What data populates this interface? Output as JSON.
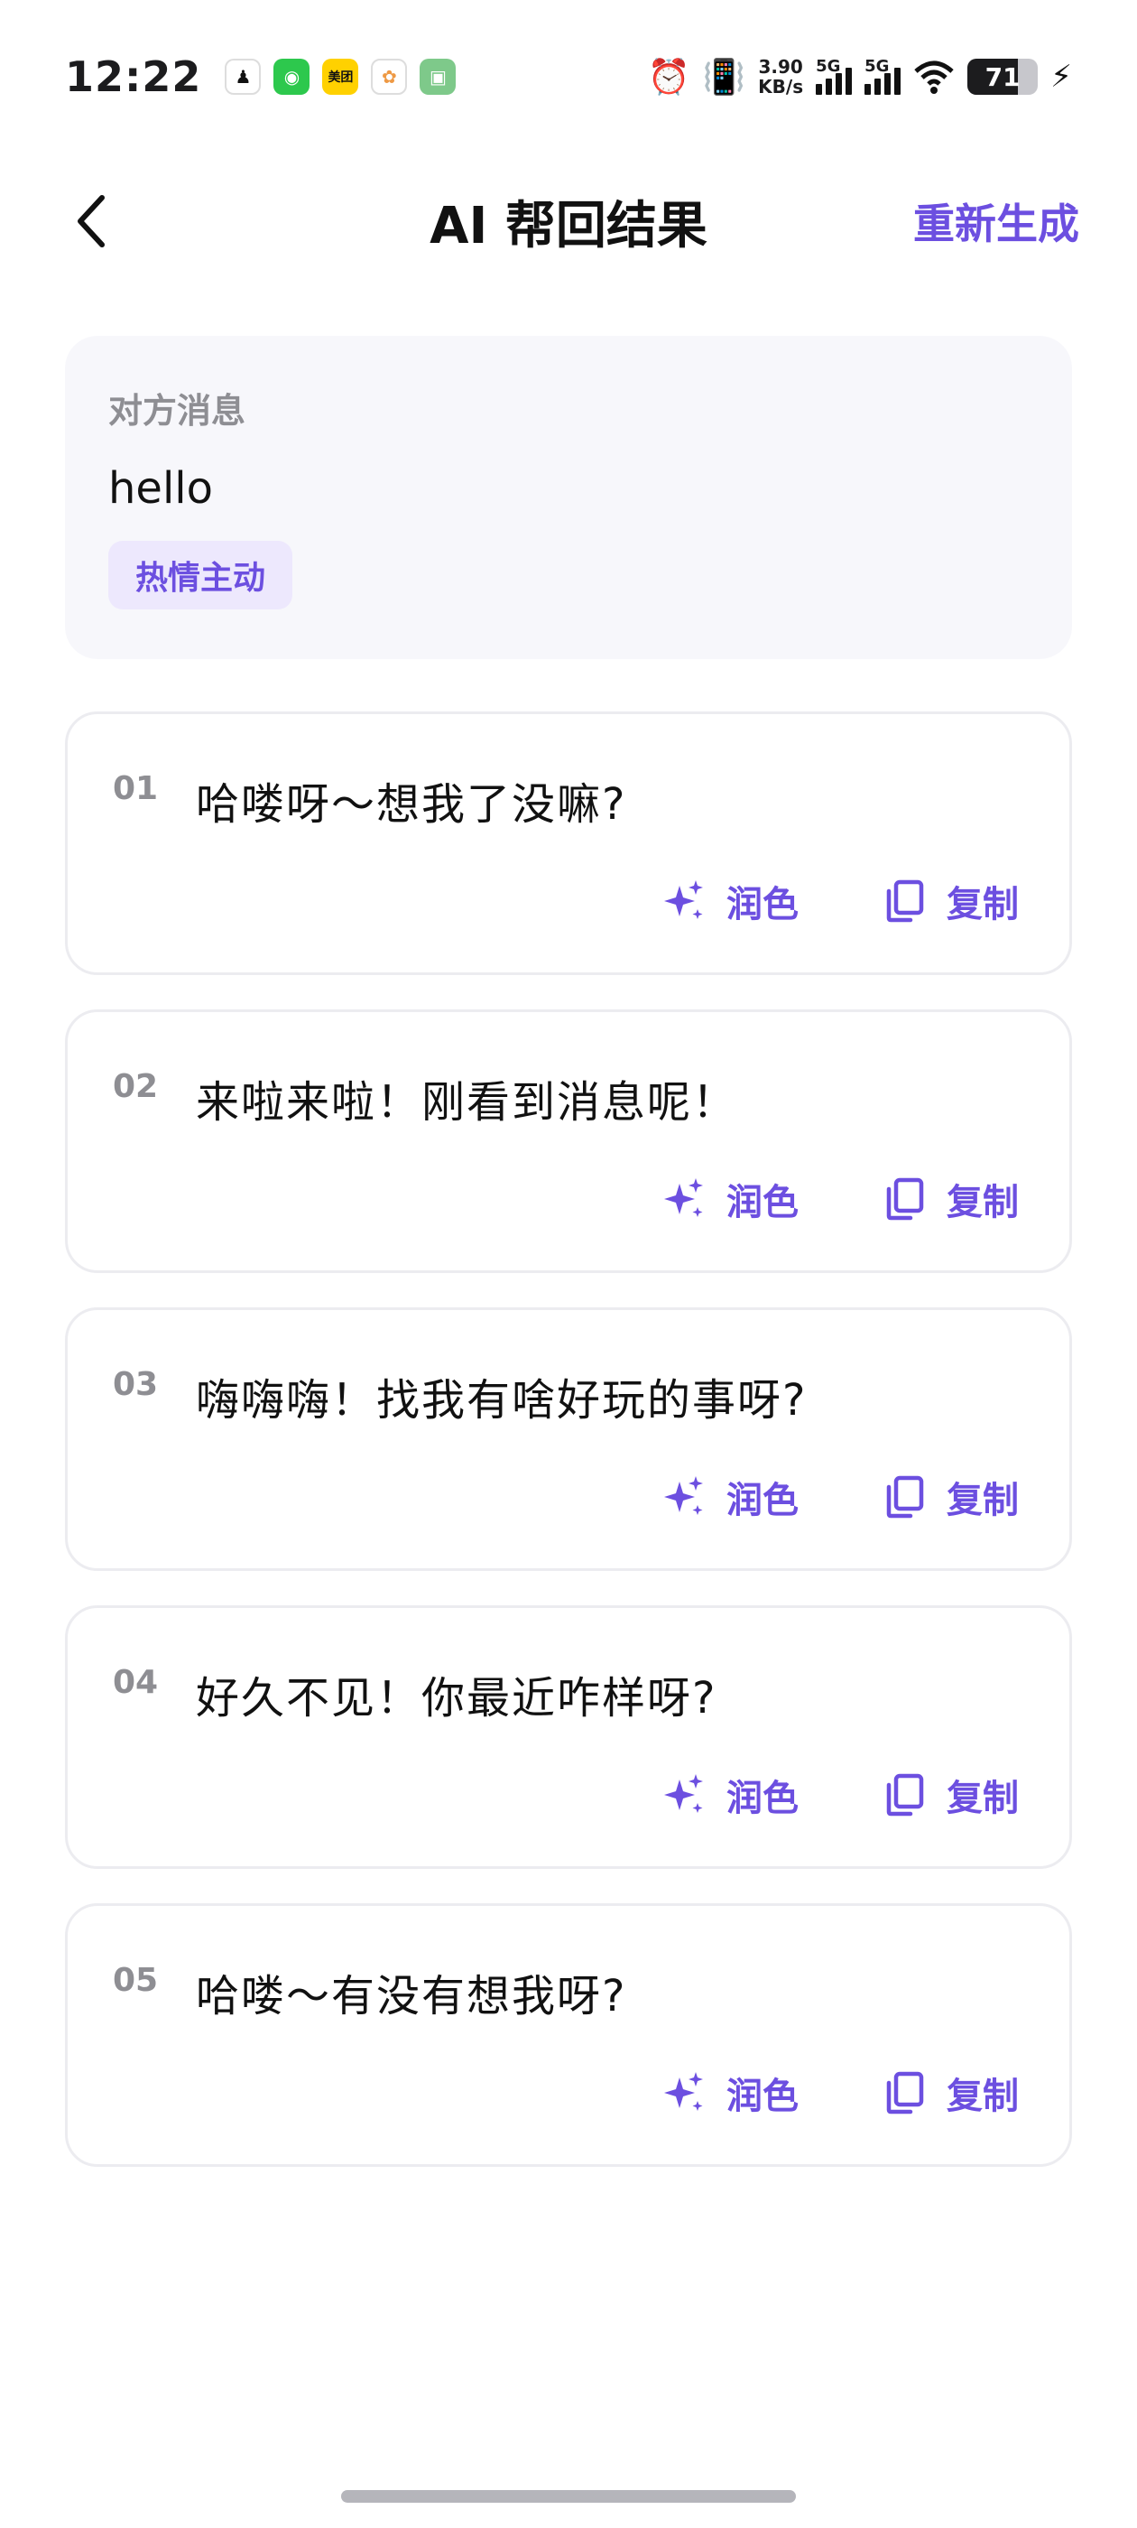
{
  "status_bar": {
    "time": "12:22",
    "apps": [
      {
        "icon": "driver-icon",
        "color": "#ffffff",
        "glyph": "♟"
      },
      {
        "icon": "wechat-icon",
        "color": "#2dc84d",
        "glyph": "◉"
      },
      {
        "icon": "meituan-icon",
        "color": "#ffd100",
        "glyph": "美团"
      },
      {
        "icon": "pinwheel-app-icon",
        "color": "#ffffff",
        "glyph": "✿"
      },
      {
        "icon": "green-app-icon",
        "color": "#7ec98a",
        "glyph": "▣"
      }
    ],
    "net_speed_value": "3.90",
    "net_speed_unit": "KB/s",
    "signal_1": "5G",
    "signal_2": "5G",
    "battery_level": "71",
    "battery_percent": 71
  },
  "header": {
    "title": "AI 帮回结果",
    "regenerate_label": "重新生成"
  },
  "source": {
    "label": "对方消息",
    "message": "hello",
    "style_tag": "热情主动"
  },
  "replies": [
    {
      "index": "01",
      "text": "哈喽呀～想我了没嘛?",
      "polish_label": "润色",
      "copy_label": "复制"
    },
    {
      "index": "02",
      "text": "来啦来啦！刚看到消息呢！",
      "polish_label": "润色",
      "copy_label": "复制"
    },
    {
      "index": "03",
      "text": "嗨嗨嗨！找我有啥好玩的事呀?",
      "polish_label": "润色",
      "copy_label": "复制"
    },
    {
      "index": "04",
      "text": "好久不见！你最近咋样呀?",
      "polish_label": "润色",
      "copy_label": "复制"
    },
    {
      "index": "05",
      "text": "哈喽～有没有想我呀?",
      "polish_label": "润色",
      "copy_label": "复制"
    }
  ],
  "colors": {
    "accent": "#6c4fe0",
    "tag_background": "#ede8fd",
    "card_border": "#ececf0",
    "source_background": "#f7f7fb"
  }
}
